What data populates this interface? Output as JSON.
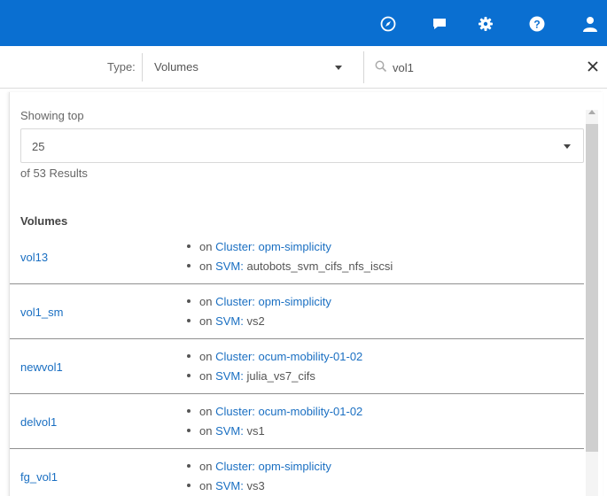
{
  "header": {
    "icons": [
      "compass-icon",
      "chat-icon",
      "gear-icon",
      "help-icon",
      "user-icon"
    ],
    "bg_color": "#0a6fd1"
  },
  "filter": {
    "type_label": "Type:",
    "type_value": "Volumes",
    "search_value": "vol1",
    "clear_symbol": "✕"
  },
  "results": {
    "showing_label": "Showing top",
    "count_value": "25",
    "total_text": "of 53 Results",
    "section_title": "Volumes",
    "items": [
      {
        "name": "vol13",
        "lines": [
          {
            "prefix": "on",
            "key": "Cluster:",
            "value": "opm-simplicity"
          },
          {
            "prefix": "on",
            "key": "SVM:",
            "value": "autobots_svm_cifs_nfs_iscsi"
          }
        ]
      },
      {
        "name": "vol1_sm",
        "lines": [
          {
            "prefix": "on",
            "key": "Cluster:",
            "value": "opm-simplicity"
          },
          {
            "prefix": "on",
            "key": "SVM:",
            "value": "vs2"
          }
        ]
      },
      {
        "name": "newvol1",
        "lines": [
          {
            "prefix": "on",
            "key": "Cluster:",
            "value": "ocum-mobility-01-02"
          },
          {
            "prefix": "on",
            "key": "SVM:",
            "value": "julia_vs7_cifs"
          }
        ]
      },
      {
        "name": "delvol1",
        "lines": [
          {
            "prefix": "on",
            "key": "Cluster:",
            "value": "ocum-mobility-01-02"
          },
          {
            "prefix": "on",
            "key": "SVM:",
            "value": "vs1"
          }
        ]
      },
      {
        "name": "fg_vol1",
        "lines": [
          {
            "prefix": "on",
            "key": "Cluster:",
            "value": "opm-simplicity"
          },
          {
            "prefix": "on",
            "key": "SVM:",
            "value": "vs3"
          }
        ]
      }
    ]
  }
}
